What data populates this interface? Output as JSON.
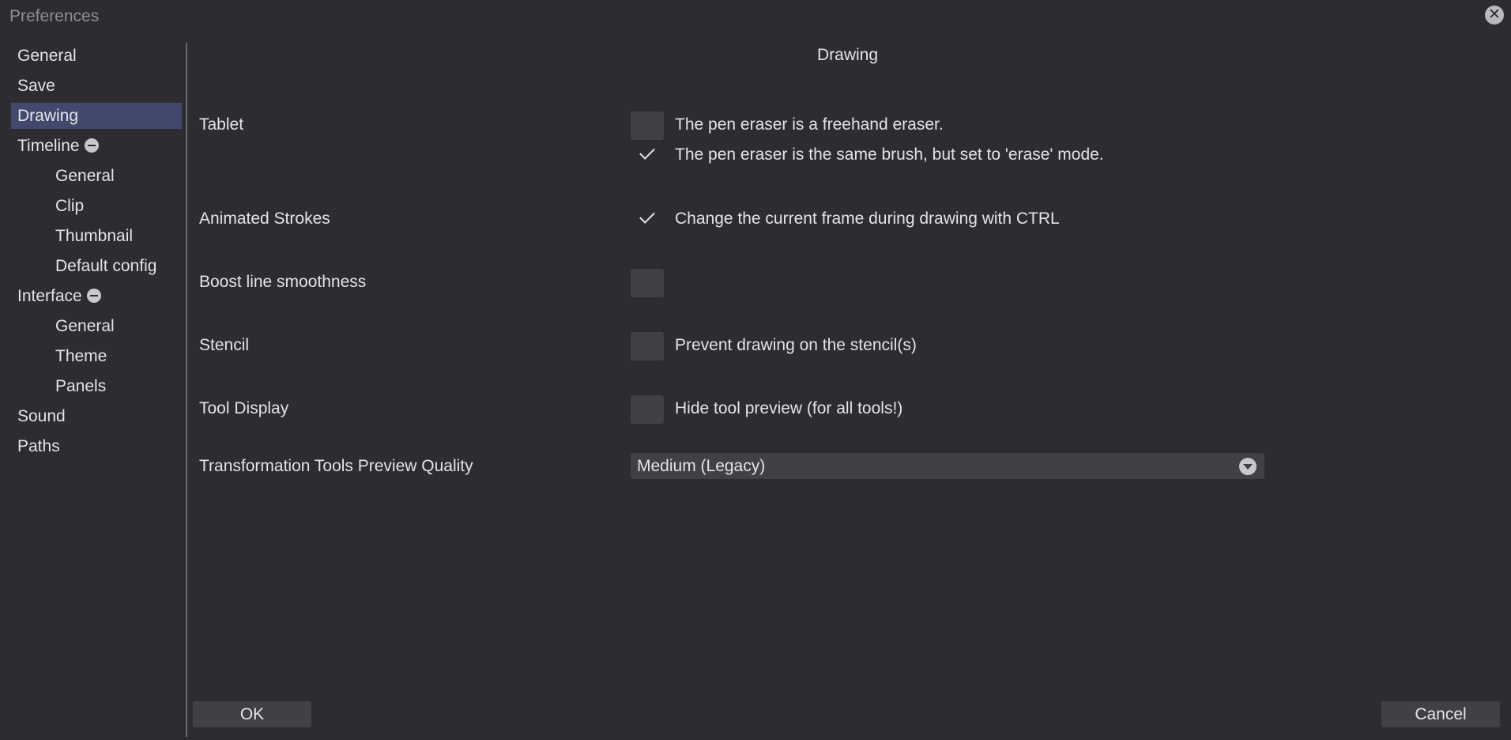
{
  "window": {
    "title": "Preferences",
    "close_icon": "close-circle-icon"
  },
  "sidebar": {
    "items": [
      {
        "label": "General",
        "level": 0
      },
      {
        "label": "Save",
        "level": 0
      },
      {
        "label": "Drawing",
        "level": 0,
        "selected": true
      },
      {
        "label": "Timeline",
        "level": 0,
        "expanded": true,
        "icon": "collapse-icon"
      },
      {
        "label": "General",
        "level": 1
      },
      {
        "label": "Clip",
        "level": 1
      },
      {
        "label": "Thumbnail",
        "level": 1
      },
      {
        "label": "Default config",
        "level": 1
      },
      {
        "label": "Interface",
        "level": 0,
        "expanded": true,
        "icon": "collapse-icon"
      },
      {
        "label": "General",
        "level": 1
      },
      {
        "label": "Theme",
        "level": 1
      },
      {
        "label": "Panels",
        "level": 1
      },
      {
        "label": "Sound",
        "level": 0
      },
      {
        "label": "Paths",
        "level": 0
      }
    ]
  },
  "main": {
    "section_title": "Drawing",
    "tablet": {
      "label": "Tablet",
      "option_freehand": {
        "text": "The pen eraser is a freehand eraser.",
        "checked": false
      },
      "option_same_brush": {
        "text": "The pen eraser is the same brush, but set to 'erase' mode.",
        "checked": true
      }
    },
    "animated_strokes": {
      "label": "Animated Strokes",
      "option": {
        "text": "Change the current frame during drawing with CTRL",
        "checked": true
      }
    },
    "boost_line_smoothness": {
      "label": "Boost line smoothness",
      "checked": false
    },
    "stencil": {
      "label": "Stencil",
      "option": {
        "text": "Prevent drawing on the stencil(s)",
        "checked": false
      }
    },
    "tool_display": {
      "label": "Tool Display",
      "option": {
        "text": "Hide tool preview (for all tools!)",
        "checked": false
      }
    },
    "transformation_quality": {
      "label": "Transformation Tools Preview Quality",
      "selected": "Medium (Legacy)"
    }
  },
  "buttons": {
    "ok": "OK",
    "cancel": "Cancel"
  },
  "colors": {
    "background": "#2d2c31",
    "selected_nav": "#414a6c",
    "control_bg": "#414046",
    "text": "#e4e4e8"
  }
}
